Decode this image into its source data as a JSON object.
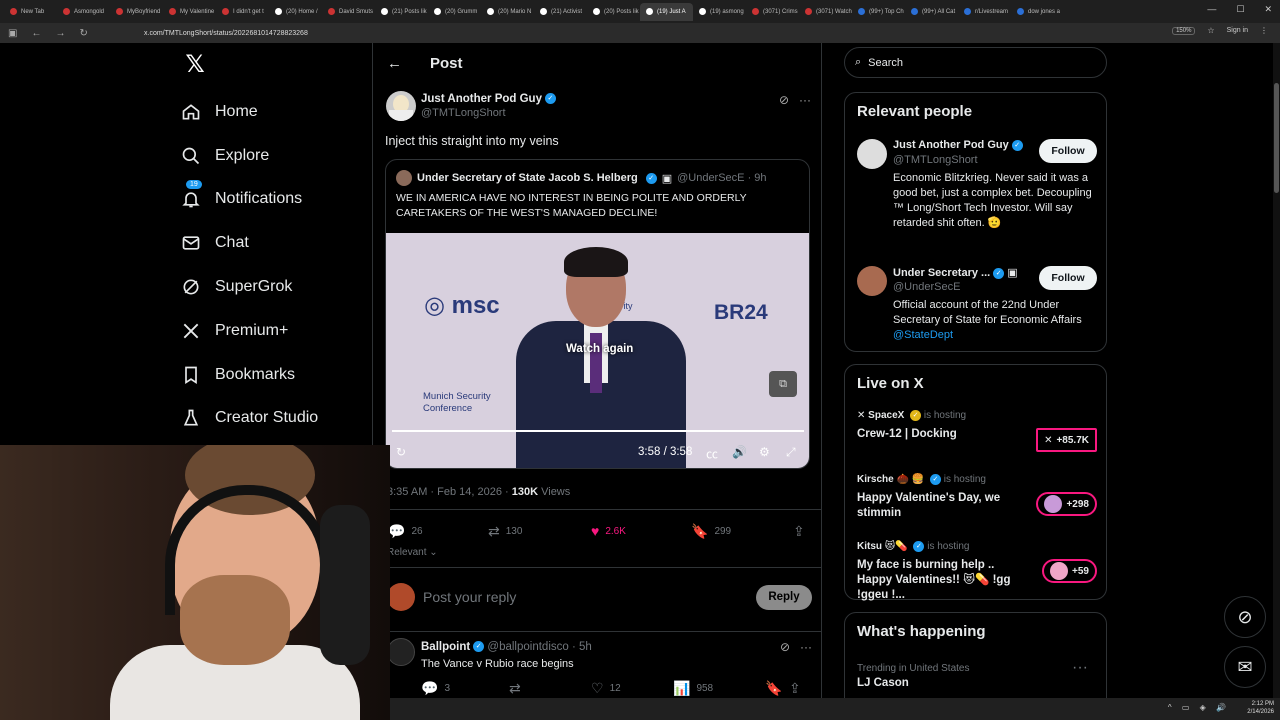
{
  "browser": {
    "tabs": [
      "New Tab",
      "Asmongold",
      "MyBoyfriend",
      "My Valentine",
      "I didn't get t",
      "(20) Home /",
      "David Smuts",
      "(21) Posts lik",
      "(20) Grumm",
      "(20) Mario N",
      "(21) Activist",
      "(20) Posts lik",
      "(19) Just A",
      "(19) asmong",
      "(3071) Crims",
      "(3071) Watch",
      "(99+) Top Ch",
      "(99+) All Cat",
      "r/Livestream",
      "dow jones a"
    ],
    "url": "x.com/TMTLongShort/status/2022681014728823268",
    "zoom": "150%",
    "signin": "Sign in"
  },
  "nav": {
    "items": [
      {
        "label": "Home",
        "icon": "home-icon"
      },
      {
        "label": "Explore",
        "icon": "search-icon"
      },
      {
        "label": "Notifications",
        "icon": "bell-icon",
        "badge": "19"
      },
      {
        "label": "Chat",
        "icon": "mail-icon"
      },
      {
        "label": "SuperGrok",
        "icon": "grok-icon"
      },
      {
        "label": "Premium+",
        "icon": "x-icon"
      },
      {
        "label": "Bookmarks",
        "icon": "bookmark-icon"
      },
      {
        "label": "Creator Studio",
        "icon": "flask-icon"
      }
    ]
  },
  "post": {
    "header": "Post",
    "author_name": "Just Another Pod Guy",
    "author_handle": "@TMTLongShort",
    "text": "Inject this straight into my veins",
    "quote": {
      "name": "Under Secretary of State Jacob S. Helberg",
      "handle": "@UnderSecE · 9h",
      "text": "WE IN AMERICA HAVE NO INTEREST IN BEING POLITE AND ORDERLY CARETAKERS OF THE WEST'S MANAGED DECLINE!",
      "video": {
        "overlay": "Watch again",
        "time": "3:58 / 3:58",
        "progress": 1.0,
        "sign_msc": "msc",
        "sign_br24": "BR24",
        "sign_munich": "Munich Security Conference",
        "sign_security": "Security"
      }
    },
    "timestamp": "3:35 AM · Feb 14, 2026 ·",
    "views_count": "130K",
    "views_label": "Views",
    "replies": "26",
    "reposts": "130",
    "likes": "2.6K",
    "bookmarks": "299",
    "sort": "Relevant"
  },
  "reply_box": {
    "placeholder": "Post your reply",
    "button": "Reply"
  },
  "reply": {
    "name": "Ballpoint",
    "handle": "@ballpointdisco · 5h",
    "text": "The Vance v Rubio race begins",
    "replies": "3",
    "likes": "12",
    "views": "958"
  },
  "sidebar": {
    "search_placeholder": "Search",
    "relevant_title": "Relevant people",
    "people": [
      {
        "name": "Just Another Pod Guy",
        "handle": "@TMTLongShort",
        "bio": "Economic Blitzkrieg. Never said it was a good bet, just a complex bet. Decoupling ™ Long/Short Tech Investor. Will say retarded shit often. 🫡",
        "follow": "Follow"
      },
      {
        "name": "Under Secretary ...",
        "handle": "@UnderSecE",
        "bio": "Official account of the 22nd Under Secretary of State for Economic Affairs",
        "bio_link": "@StateDept",
        "follow": "Follow"
      }
    ],
    "live_title": "Live on X",
    "live": [
      {
        "host": "SpaceX",
        "hosting": "is hosting",
        "title": "Crew-12 | Docking",
        "count": "+85.7K"
      },
      {
        "host": "Kirsche 🌰 🍔",
        "hosting": "is hosting",
        "title": "Happy Valentine's Day, we stimmin",
        "count": "+298"
      },
      {
        "host": "Kitsu 😻💊",
        "hosting": "is hosting",
        "title": "My face is burning help .. Happy Valentines!! 😻💊 !gg !ggeu !...",
        "count": "+59"
      }
    ],
    "happening_title": "What's happening",
    "trend_context": "Trending in United States",
    "trend_name": "LJ Cason"
  },
  "taskbar": {
    "time": "2:12 PM",
    "date": "2/14/2026"
  },
  "colors": {
    "accent": "#1d9bf0",
    "like": "#f91880",
    "background": "#000000"
  }
}
